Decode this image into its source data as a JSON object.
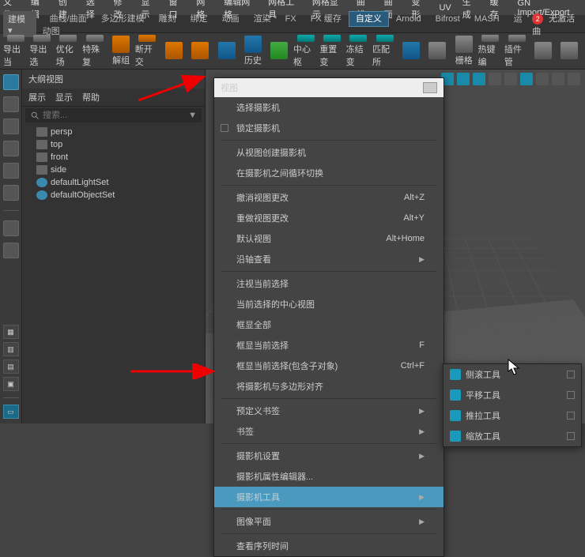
{
  "menubar": [
    "文件",
    "编辑",
    "创建",
    "选择",
    "修改",
    "显示",
    "窗口",
    "网格",
    "编辑网格",
    "网格工具",
    "网格显示",
    "曲线",
    "曲面",
    "变形",
    "UV",
    "生成",
    "缓存",
    "GN Import/Export"
  ],
  "shelf": {
    "dropdown": "建模",
    "tabs": [
      "曲线/曲面",
      "多边形建模",
      "雕刻",
      "绑定",
      "动画",
      "渲染",
      "FX",
      "FX 缓存",
      "自定义",
      "Arnold",
      "Bifrost",
      "MASH",
      "运动图"
    ],
    "active": "自定义",
    "status_badge": "2",
    "status_text": "无激活曲"
  },
  "tools": [
    {
      "label": "导出当",
      "cls": "gray"
    },
    {
      "label": "导出选",
      "cls": "gray"
    },
    {
      "label": "优化场",
      "cls": "gray"
    },
    {
      "label": "特殊复",
      "cls": "gray"
    },
    {
      "label": "解组",
      "cls": "orange"
    },
    {
      "label": "断开交",
      "cls": "orange"
    },
    {
      "label": "",
      "cls": "orange"
    },
    {
      "label": "",
      "cls": "orange"
    },
    {
      "label": "",
      "cls": "blue"
    },
    {
      "label": "历史",
      "cls": "blue"
    },
    {
      "label": "",
      "cls": "green"
    },
    {
      "label": "中心枢",
      "cls": "teal"
    },
    {
      "label": "重置变",
      "cls": "teal"
    },
    {
      "label": "冻结变",
      "cls": "teal"
    },
    {
      "label": "匹配所",
      "cls": "teal"
    },
    {
      "label": "",
      "cls": "blue"
    },
    {
      "label": "",
      "cls": "gray"
    },
    {
      "label": "栅格",
      "cls": "gray"
    },
    {
      "label": "热键编",
      "cls": "gray"
    },
    {
      "label": "插件管",
      "cls": "gray"
    },
    {
      "label": "",
      "cls": "gray"
    },
    {
      "label": "",
      "cls": "gray"
    }
  ],
  "outliner": {
    "title": "大纲视图",
    "menu": [
      "展示",
      "显示",
      "帮助"
    ],
    "search_placeholder": "搜索...",
    "items": [
      {
        "name": "persp",
        "type": "cam"
      },
      {
        "name": "top",
        "type": "cam"
      },
      {
        "name": "front",
        "type": "cam"
      },
      {
        "name": "side",
        "type": "cam"
      },
      {
        "name": "defaultLightSet",
        "type": "set"
      },
      {
        "name": "defaultObjectSet",
        "type": "set"
      }
    ]
  },
  "context_menu": {
    "header": "视图",
    "items": [
      {
        "label": "选择摄影机"
      },
      {
        "label": "锁定摄影机",
        "checkbox": true
      },
      {
        "sep": true
      },
      {
        "label": "从视图创建摄影机"
      },
      {
        "label": "在摄影机之间循环切换"
      },
      {
        "sep": true
      },
      {
        "label": "撤消视图更改",
        "shortcut": "Alt+Z"
      },
      {
        "label": "重做视图更改",
        "shortcut": "Alt+Y"
      },
      {
        "label": "默认视图",
        "shortcut": "Alt+Home"
      },
      {
        "label": "沿轴查看",
        "submenu": true
      },
      {
        "sep": true
      },
      {
        "label": "注视当前选择"
      },
      {
        "label": "当前选择的中心视图"
      },
      {
        "label": "框显全部"
      },
      {
        "label": "框显当前选择",
        "shortcut": "F"
      },
      {
        "label": "框显当前选择(包含子对象)",
        "shortcut": "Ctrl+F"
      },
      {
        "label": "将摄影机与多边形对齐"
      },
      {
        "sep": true
      },
      {
        "label": "预定义书签",
        "submenu": true
      },
      {
        "label": "书签",
        "submenu": true
      },
      {
        "sep": true
      },
      {
        "label": "摄影机设置",
        "submenu": true
      },
      {
        "label": "摄影机属性编辑器..."
      },
      {
        "label": "摄影机工具",
        "submenu": true,
        "selected": true
      },
      {
        "sep": true
      },
      {
        "label": "图像平面",
        "submenu": true
      },
      {
        "sep": true
      },
      {
        "label": "查看序列时间"
      }
    ]
  },
  "submenu": {
    "items": [
      {
        "label": "侧滚工具"
      },
      {
        "label": "平移工具"
      },
      {
        "label": "推拉工具"
      },
      {
        "label": "缩放工具"
      }
    ]
  }
}
